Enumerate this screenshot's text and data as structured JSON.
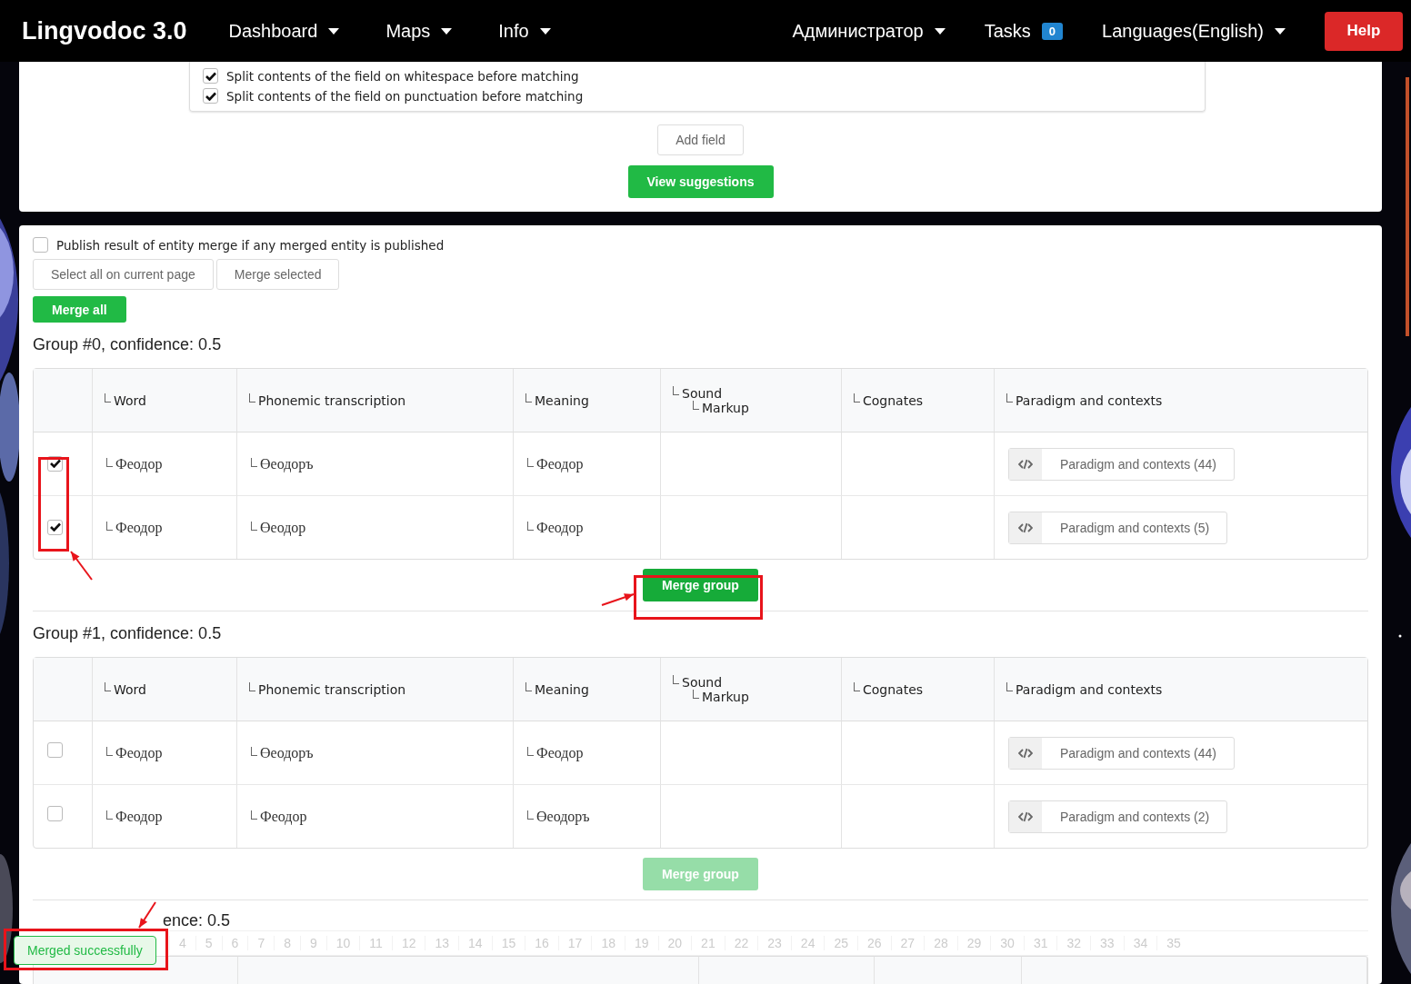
{
  "navbar": {
    "brand": "Lingvodoc 3.0",
    "items": [
      {
        "label": "Dashboard",
        "kind": "dropdown"
      },
      {
        "label": "Maps",
        "kind": "dropdown"
      },
      {
        "label": "Info",
        "kind": "dropdown"
      }
    ],
    "right_items": [
      {
        "label": "Администратор",
        "kind": "dropdown"
      },
      {
        "label": "Tasks",
        "kind": "badge",
        "badge": "0"
      },
      {
        "label": "Languages(English)",
        "kind": "dropdown"
      }
    ],
    "help_button": "Help"
  },
  "options": [
    {
      "label": "Split contents of the field on whitespace before matching",
      "checked": true
    },
    {
      "label": "Split contents of the field on punctuation before matching",
      "checked": true
    }
  ],
  "add_field_button": "Add field",
  "view_suggestions_button": "View suggestions",
  "publish_option": {
    "label": "Publish result of entity merge if any merged entity is published",
    "checked": false
  },
  "select_all_button": "Select all on current page",
  "merge_selected_button": "Merge selected",
  "merge_all_button": "Merge all",
  "groups": [
    {
      "title": "Group #0, confidence: 0.5",
      "merge_button": {
        "label": "Merge group",
        "disabled": false
      },
      "columns": [
        {
          "label": "Word"
        },
        {
          "label": "Phonemic transcription"
        },
        {
          "label": "Meaning"
        },
        {
          "label": "Sound",
          "children": [
            {
              "label": "Markup"
            }
          ]
        },
        {
          "label": "Cognates"
        },
        {
          "label": "Paradigm and contexts"
        }
      ],
      "rows": [
        {
          "checked": true,
          "word": "Феодор",
          "phonemic": "Өеодоръ",
          "meaning": "Феодор",
          "paradigm": "Paradigm and contexts (44)"
        },
        {
          "checked": true,
          "word": "Феодор",
          "phonemic": "Өеодор",
          "meaning": "Феодор",
          "paradigm": "Paradigm and contexts (5)"
        }
      ]
    },
    {
      "title": "Group #1, confidence: 0.5",
      "merge_button": {
        "label": "Merge group",
        "disabled": true
      },
      "columns": [
        {
          "label": "Word"
        },
        {
          "label": "Phonemic transcription"
        },
        {
          "label": "Meaning"
        },
        {
          "label": "Sound",
          "children": [
            {
              "label": "Markup"
            }
          ]
        },
        {
          "label": "Cognates"
        },
        {
          "label": "Paradigm and contexts"
        }
      ],
      "rows": [
        {
          "checked": false,
          "word": "Феодор",
          "phonemic": "Өеодоръ",
          "meaning": "Феодор",
          "paradigm": "Paradigm and contexts (44)"
        },
        {
          "checked": false,
          "word": "Феодор",
          "phonemic": "Феодор",
          "meaning": "Өеодоръ",
          "paradigm": "Paradigm and contexts (2)"
        }
      ]
    }
  ],
  "partial_group": {
    "title": "ence: 0.5",
    "ruler": [
      "4",
      "5",
      "6",
      "7",
      "8",
      "9",
      "10",
      "11",
      "12",
      "13",
      "14",
      "15",
      "16",
      "17",
      "18",
      "19",
      "20",
      "21",
      "22",
      "23",
      "24",
      "25",
      "26",
      "27",
      "28",
      "29",
      "30",
      "31",
      "32",
      "33",
      "34",
      "35"
    ]
  },
  "toast": {
    "message": "Merged successfully"
  }
}
